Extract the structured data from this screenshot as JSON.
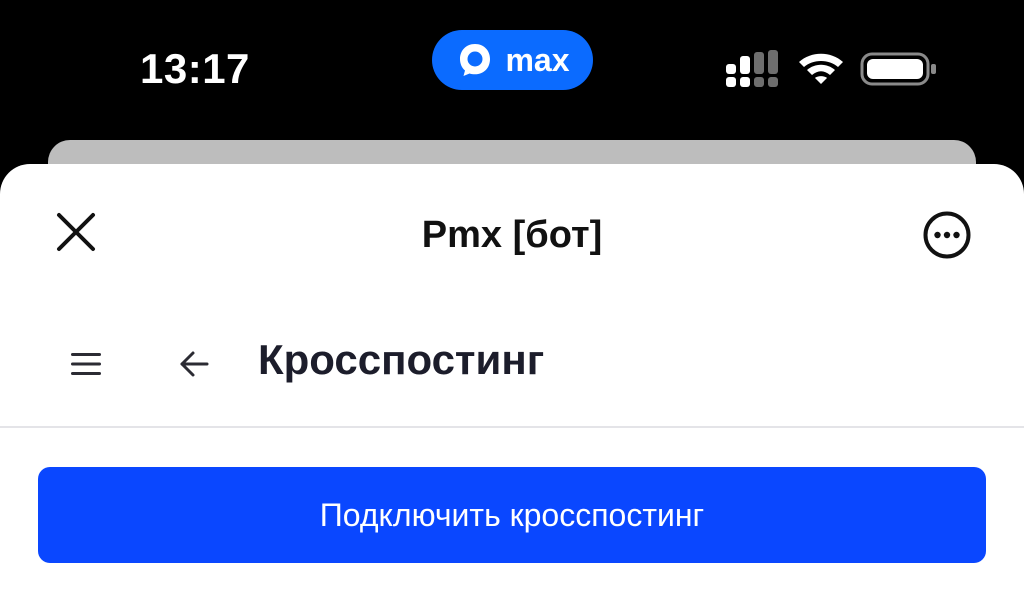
{
  "status_bar": {
    "time": "13:17",
    "app_pill": {
      "label": "max",
      "icon": "max-chat-logo-icon",
      "color": "#0b6bff"
    },
    "icons": [
      "signal-icon",
      "wifi-icon",
      "battery-icon"
    ]
  },
  "header": {
    "title": "Pmx [бот]",
    "close_icon": "close-icon",
    "more_icon": "more-options-icon"
  },
  "nav": {
    "menu_icon": "hamburger-menu-icon",
    "back_icon": "back-arrow-icon",
    "page_title": "Кросспостинг"
  },
  "actions": {
    "connect_label": "Подключить кросспостинг",
    "connect_color": "#0a47ff"
  }
}
